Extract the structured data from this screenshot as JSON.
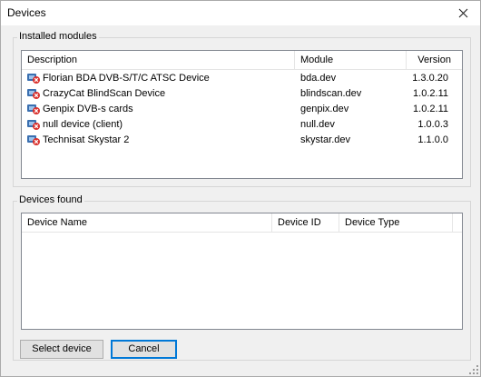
{
  "window": {
    "title": "Devices"
  },
  "installed": {
    "legend": "Installed modules",
    "columns": {
      "description": "Description",
      "module": "Module",
      "version": "Version"
    },
    "rows": [
      {
        "description": "Florian BDA DVB-S/T/C ATSC Device",
        "module": "bda.dev",
        "version": "1.3.0.20"
      },
      {
        "description": "CrazyCat BlindScan Device",
        "module": "blindscan.dev",
        "version": "1.0.2.11"
      },
      {
        "description": "Genpix DVB-s cards",
        "module": "genpix.dev",
        "version": "1.0.2.11"
      },
      {
        "description": "null device (client)",
        "module": "null.dev",
        "version": "1.0.0.3"
      },
      {
        "description": "Technisat Skystar 2",
        "module": "skystar.dev",
        "version": "1.1.0.0"
      }
    ]
  },
  "found": {
    "legend": "Devices found",
    "columns": {
      "name": "Device Name",
      "id": "Device ID",
      "type": "Device Type"
    }
  },
  "buttons": {
    "select": "Select device",
    "cancel": "Cancel"
  },
  "icons": {
    "close": "close-icon",
    "module": "device-module-icon",
    "grip": "resize-grip-icon"
  },
  "colors": {
    "accent": "#0078d7",
    "icon_red": "#d9302c",
    "icon_blue": "#3a6fb0"
  }
}
